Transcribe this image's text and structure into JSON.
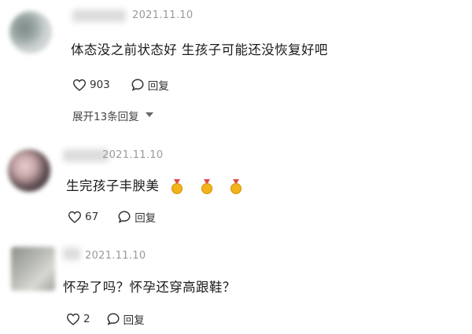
{
  "comments": [
    {
      "date": "2021.11.10",
      "text": "体态没之前状态好 生孩子可能还没恢复好吧",
      "likes": "903",
      "reply_label": "回复",
      "expand_label": "展开13条回复"
    },
    {
      "date": "2021.11.10",
      "text": "生完孩子丰腴美",
      "emoji": [
        "medal-icon",
        "medal-icon",
        "medal-icon"
      ],
      "likes": "67",
      "reply_label": "回复"
    },
    {
      "date": "2021.11.10",
      "text": "怀孕了吗？怀孕还穿高跟鞋？",
      "likes": "2",
      "reply_label": "回复"
    }
  ],
  "colors": {
    "text": "#1b1b1b",
    "meta": "#9a9a9a",
    "medal_gold": "#f2b21b",
    "medal_ribbon": "#e24a4a"
  }
}
